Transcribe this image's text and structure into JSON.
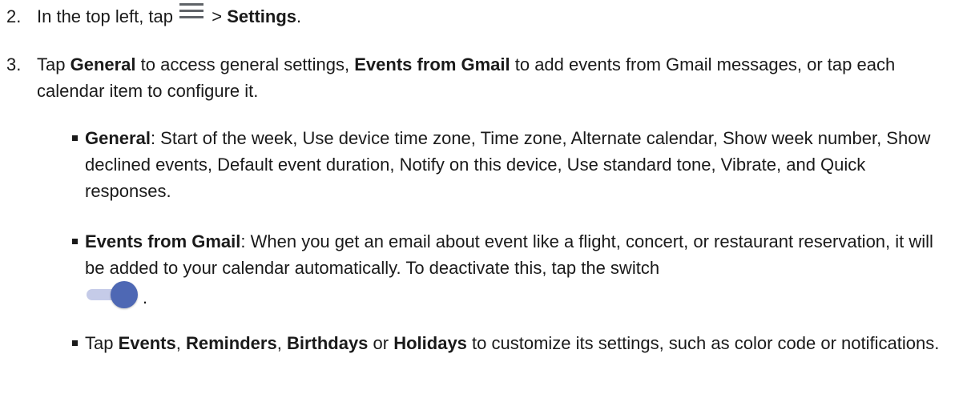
{
  "step2": {
    "number": "2.",
    "text_before": "In the top left, tap",
    "icon": "hamburger-menu-icon",
    "text_middle": " > ",
    "bold_settings": "Settings",
    "text_after": "."
  },
  "step3": {
    "number": "3.",
    "text_a": "Tap ",
    "bold_general": "General",
    "text_b": " to access general settings, ",
    "bold_events_gmail": "Events from Gmail",
    "text_c": " to add events from Gmail messages, or tap each calendar item to configure it."
  },
  "bullets": {
    "general": {
      "bold": "General",
      "text": ": Start of the week, Use device time zone, Time zone, Alternate calendar, Show week number, Show declined events, Default event duration, Notify on this device, Use standard tone, Vibrate, and Quick responses."
    },
    "gmail": {
      "bold": "Events from Gmail",
      "text": ": When you get an email about event like a flight, concert, or restaurant reservation, it will be added to your calendar automatically. To deactivate this, tap the switch",
      "switch_icon": "toggle-switch-on-icon",
      "after": "."
    },
    "calendars": {
      "text_a": "Tap ",
      "bold_events": "Events",
      "sep1": ", ",
      "bold_reminders": "Reminders",
      "sep2": ", ",
      "bold_birthdays": "Birthdays",
      "sep3": " or ",
      "bold_holidays": "Holidays",
      "text_b": " to customize its settings, such as color code or notifications."
    }
  },
  "colors": {
    "switch_knob": "#4e68b4",
    "switch_track": "#c5cbe8",
    "menu_icon": "#5f6368"
  }
}
